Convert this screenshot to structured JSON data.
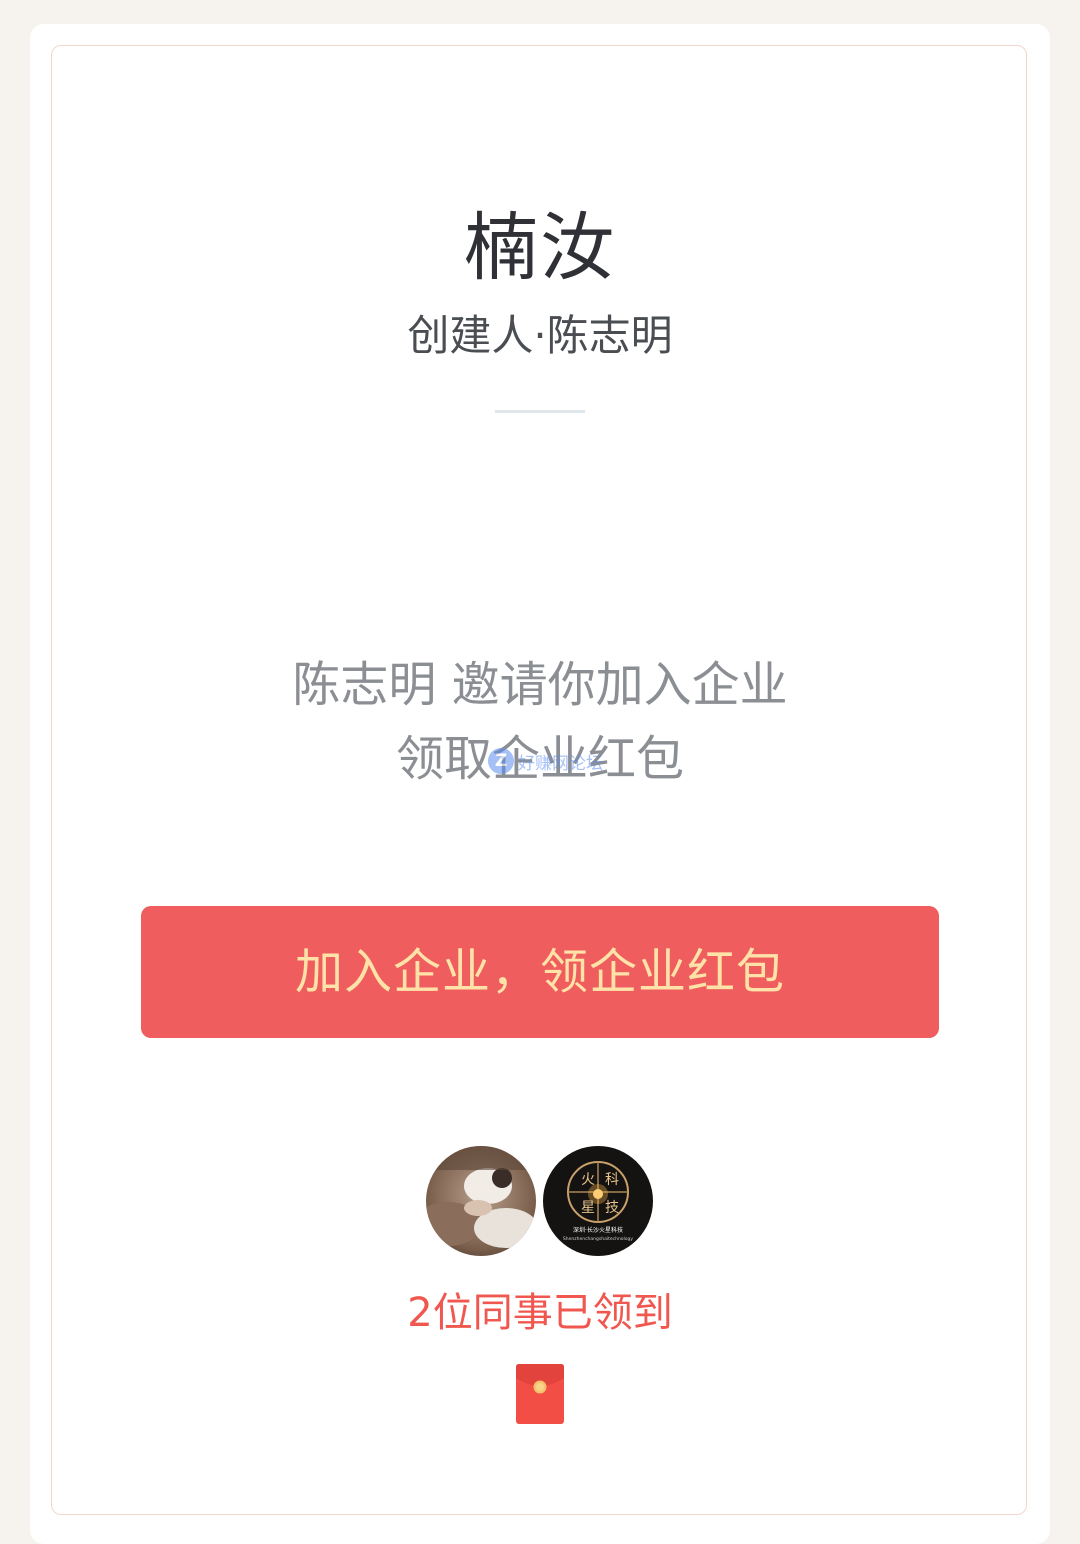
{
  "company": {
    "name": "楠汝",
    "creator_line": "创建人·陈志明"
  },
  "invite": {
    "line1": "陈志明 邀请你加入企业",
    "line2": "领取企业红包"
  },
  "watermark": {
    "badge": "Z",
    "text": "好赚网论坛"
  },
  "action": {
    "join_label": "加入企业，领企业红包"
  },
  "colleagues": {
    "claimed_text": "2位同事已领到",
    "avatars": [
      {
        "icon": "user-avatar-photo"
      },
      {
        "icon": "user-avatar-logo",
        "caption_line1": "深圳·长沙火星科技",
        "caption_line2": "Shenzhenchangshaitechnology"
      }
    ]
  },
  "colors": {
    "background": "#f6f3ef",
    "card_border": "#f2d6cc",
    "button": "#ef5d5e",
    "button_text": "#ffe2a8",
    "accent_red": "#f0584f"
  },
  "icons": {
    "envelope": "red-envelope-icon"
  }
}
